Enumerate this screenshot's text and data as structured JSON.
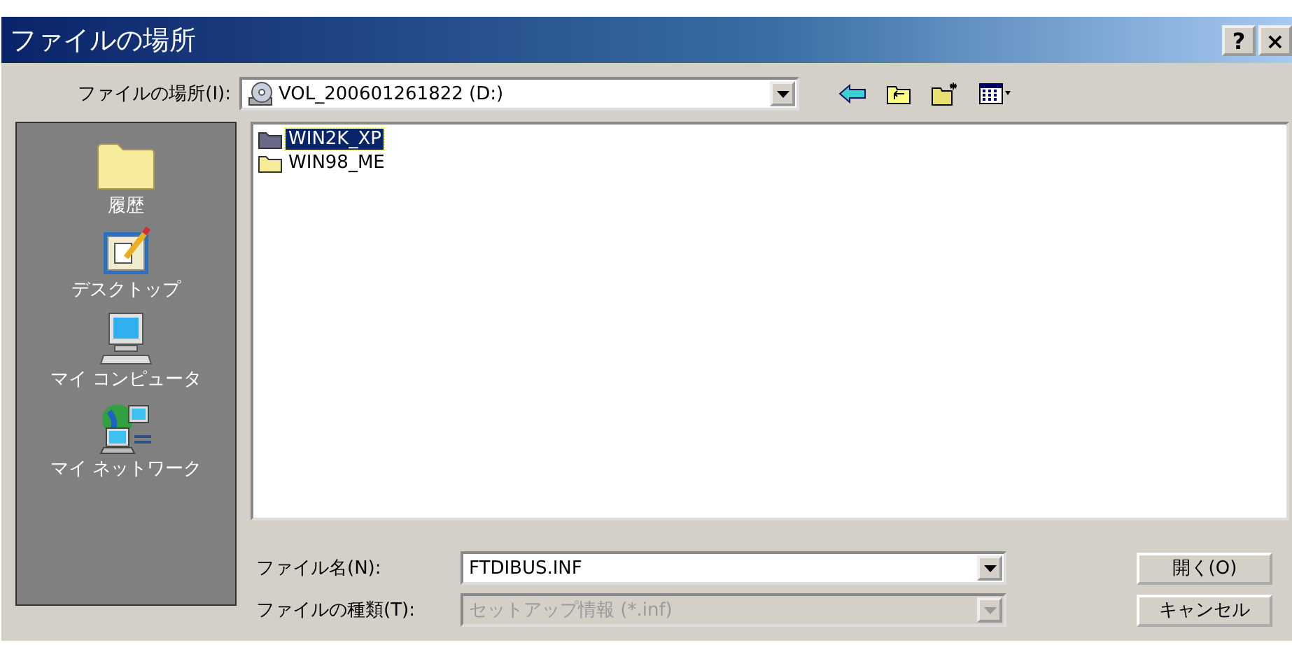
{
  "window": {
    "title": "ファイルの場所",
    "buttons": [
      "?",
      "×"
    ]
  },
  "location": {
    "label": "ファイルの場所(I):",
    "value": "VOL_200601261822 (D:)"
  },
  "toolbar": [
    {
      "kind": "back"
    },
    {
      "kind": "up"
    },
    {
      "kind": "newfolder"
    },
    {
      "kind": "view"
    }
  ],
  "places": [
    {
      "kind": "history",
      "label": "履歴"
    },
    {
      "kind": "desktop",
      "label": "デスクトップ"
    },
    {
      "kind": "computer",
      "label": "マイ コンピュータ"
    },
    {
      "kind": "network",
      "label": "マイ ネットワーク"
    }
  ],
  "files": [
    {
      "name": "WIN2K_XP",
      "selected": true
    },
    {
      "name": "WIN98_ME",
      "selected": false
    }
  ],
  "filename": {
    "label": "ファイル名(N):",
    "value": "FTDIBUS.INF",
    "disabled": false
  },
  "filetype": {
    "label": "ファイルの種類(T):",
    "value": "セットアップ情報 (*.inf)",
    "disabled": true
  },
  "buttons": [
    "開く(O)",
    "キャンセル"
  ]
}
